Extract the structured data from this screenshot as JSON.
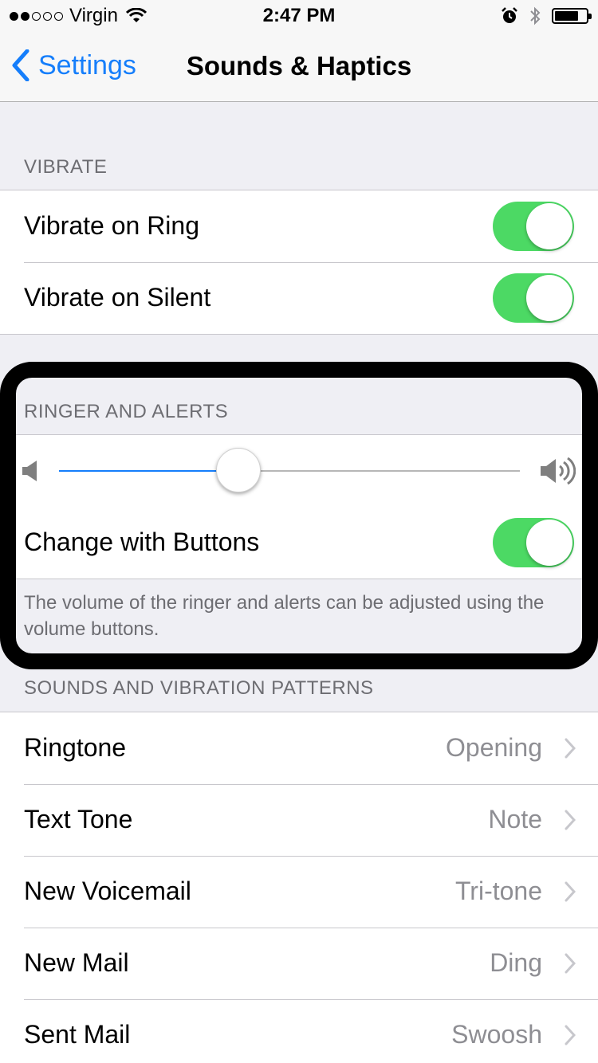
{
  "status_bar": {
    "carrier": "Virgin",
    "time": "2:47 PM",
    "signal_bars": 2,
    "signal_total": 5,
    "battery_level": 0.75
  },
  "nav": {
    "back_label": "Settings",
    "title": "Sounds & Haptics"
  },
  "vibrate": {
    "header": "VIBRATE",
    "rows": [
      {
        "label": "Vibrate on Ring",
        "on": true
      },
      {
        "label": "Vibrate on Silent",
        "on": true
      }
    ]
  },
  "ringer": {
    "header": "RINGER AND ALERTS",
    "volume_level": 0.39,
    "change_with_buttons_label": "Change with Buttons",
    "change_with_buttons_on": true,
    "footer": "The volume of the ringer and alerts can be adjusted using the volume buttons."
  },
  "patterns": {
    "header": "SOUNDS AND VIBRATION PATTERNS",
    "rows": [
      {
        "label": "Ringtone",
        "value": "Opening"
      },
      {
        "label": "Text Tone",
        "value": "Note"
      },
      {
        "label": "New Voicemail",
        "value": "Tri-tone"
      },
      {
        "label": "New Mail",
        "value": "Ding"
      },
      {
        "label": "Sent Mail",
        "value": "Swoosh"
      }
    ]
  },
  "colors": {
    "accent": "#157efb",
    "toggle_on": "#4cd964",
    "background": "#efeff4"
  }
}
